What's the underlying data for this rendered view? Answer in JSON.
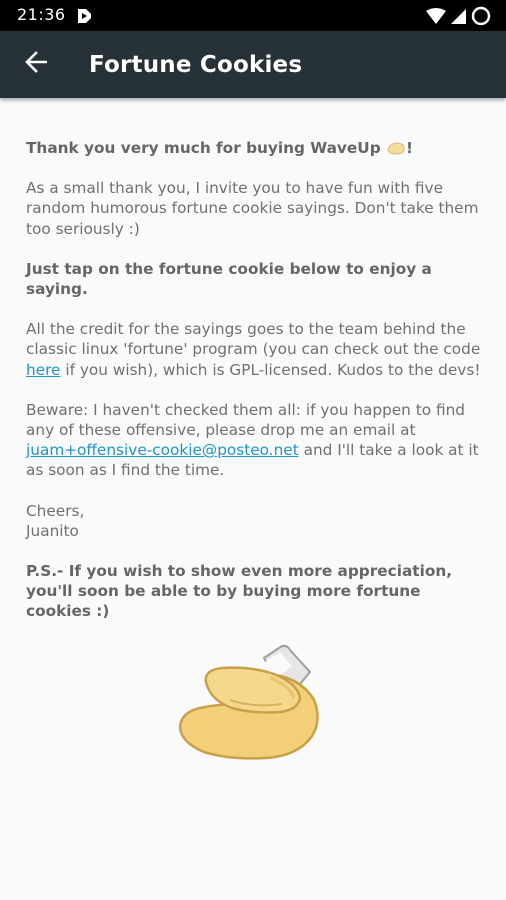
{
  "status_bar": {
    "time": "21:36",
    "icons": [
      "app-notification-icon",
      "wifi-icon",
      "cell-signal-icon",
      "battery-icon"
    ]
  },
  "app_bar": {
    "title": "Fortune Cookies",
    "back_icon": "arrow-back-icon",
    "background_color": "#263238"
  },
  "content": {
    "thanks_prefix": "Thank you very much for buying WaveUp",
    "thanks_suffix": "!",
    "intro": "As a small thank you, I invite you to have fun with five random humorous fortune cookie sayings. Don't take them too seriously :)",
    "instruction": "Just tap on the fortune cookie below to enjoy a saying.",
    "credit_before_link": "All the credit for the sayings goes to the team behind the classic linux 'fortune' program (you can check out the code ",
    "credit_link": "here",
    "credit_after_link": " if you wish), which is GPL-licensed. Kudos to the devs!",
    "beware_before_link": "Beware: I haven't checked them all: if you happen to find any of these offensive, please drop me an email at ",
    "beware_email": "juam+offensive-cookie@posteo.net",
    "beware_after_link": " and I'll take a look at it as soon as I find the time.",
    "signoff_line1": "Cheers,",
    "signoff_line2": "Juanito",
    "ps": "P.S.- If you wish to show even more appreciation, you'll soon be able to by buying more fortune cookies :)",
    "link_color": "#2196c8"
  },
  "cookie": {
    "icon": "fortune-cookie-icon"
  }
}
